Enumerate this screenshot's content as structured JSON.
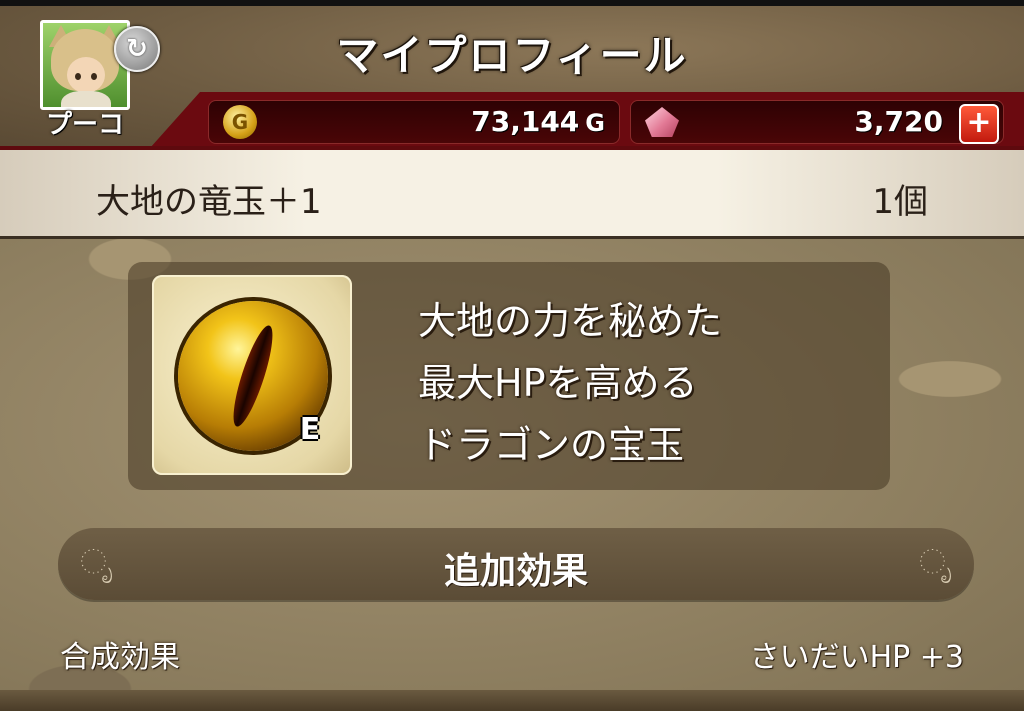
{
  "header": {
    "title": "マイプロフィール",
    "player_name": "プーコ",
    "swap_icon": "↻"
  },
  "currency": {
    "gold_icon": "G",
    "gold_value": "73,144",
    "gold_unit": "G",
    "gem_value": "3,720",
    "add_label": "+"
  },
  "item": {
    "name": "大地の竜玉＋1",
    "count": "1個",
    "equip_badge": "E",
    "description": [
      "大地の力を秘めた",
      "最大HPを高める",
      "ドラゴンの宝玉"
    ]
  },
  "section": {
    "title": "追加効果",
    "flourish_left": "ೃ",
    "flourish_right": "ೃ"
  },
  "effect": {
    "label": "合成効果",
    "value": "さいだいHP  +3"
  },
  "colors": {
    "header_red": "#6b0a10",
    "item_bar": "#f6f1e4",
    "panel_bg": "#8e7f60"
  }
}
